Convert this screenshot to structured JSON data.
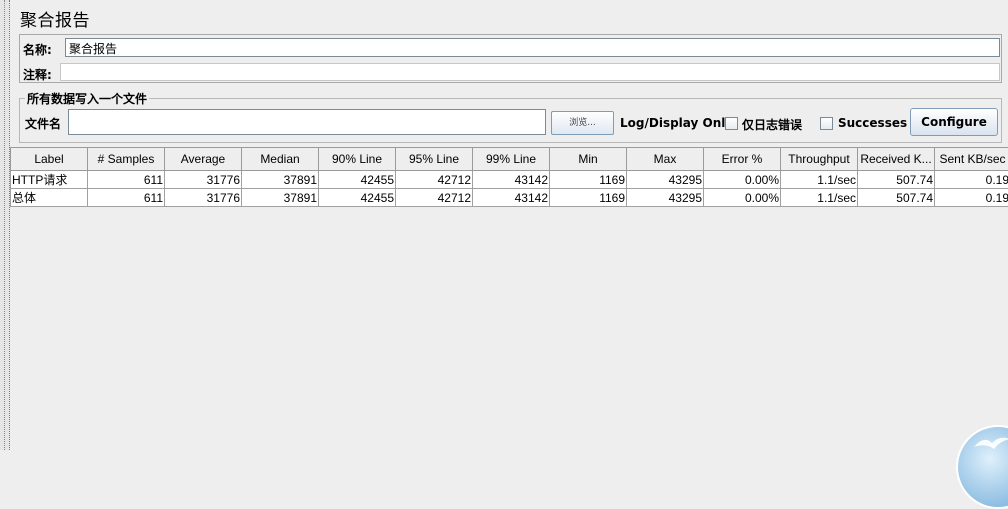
{
  "header": {
    "title": "聚合报告"
  },
  "form": {
    "name_label": "名称:",
    "name_value": "聚合报告",
    "comment_label": "注释:",
    "comment_value": ""
  },
  "file_section": {
    "title": "所有数据写入一个文件",
    "file_label": "文件名",
    "file_value": "",
    "browse_label": "浏览...",
    "log_display_label": "Log/Display Only:",
    "errors_label": "仅日志错误",
    "errors_checked": false,
    "successes_label": "Successes",
    "successes_checked": false,
    "configure_label": "Configure"
  },
  "table": {
    "columns": [
      "Label",
      "# Samples",
      "Average",
      "Median",
      "90% Line",
      "95% Line",
      "99% Line",
      "Min",
      "Max",
      "Error %",
      "Throughput",
      "Received K...",
      "Sent KB/sec"
    ],
    "rows": [
      [
        "HTTP请求",
        "611",
        "31776",
        "37891",
        "42455",
        "42712",
        "43142",
        "1169",
        "43295",
        "0.00%",
        "1.1/sec",
        "507.74",
        "0.19"
      ],
      [
        "总体",
        "611",
        "31776",
        "37891",
        "42455",
        "42712",
        "43142",
        "1169",
        "43295",
        "0.00%",
        "1.1/sec",
        "507.74",
        "0.19"
      ]
    ]
  },
  "icons": {
    "corner_badge": "bird-icon"
  }
}
